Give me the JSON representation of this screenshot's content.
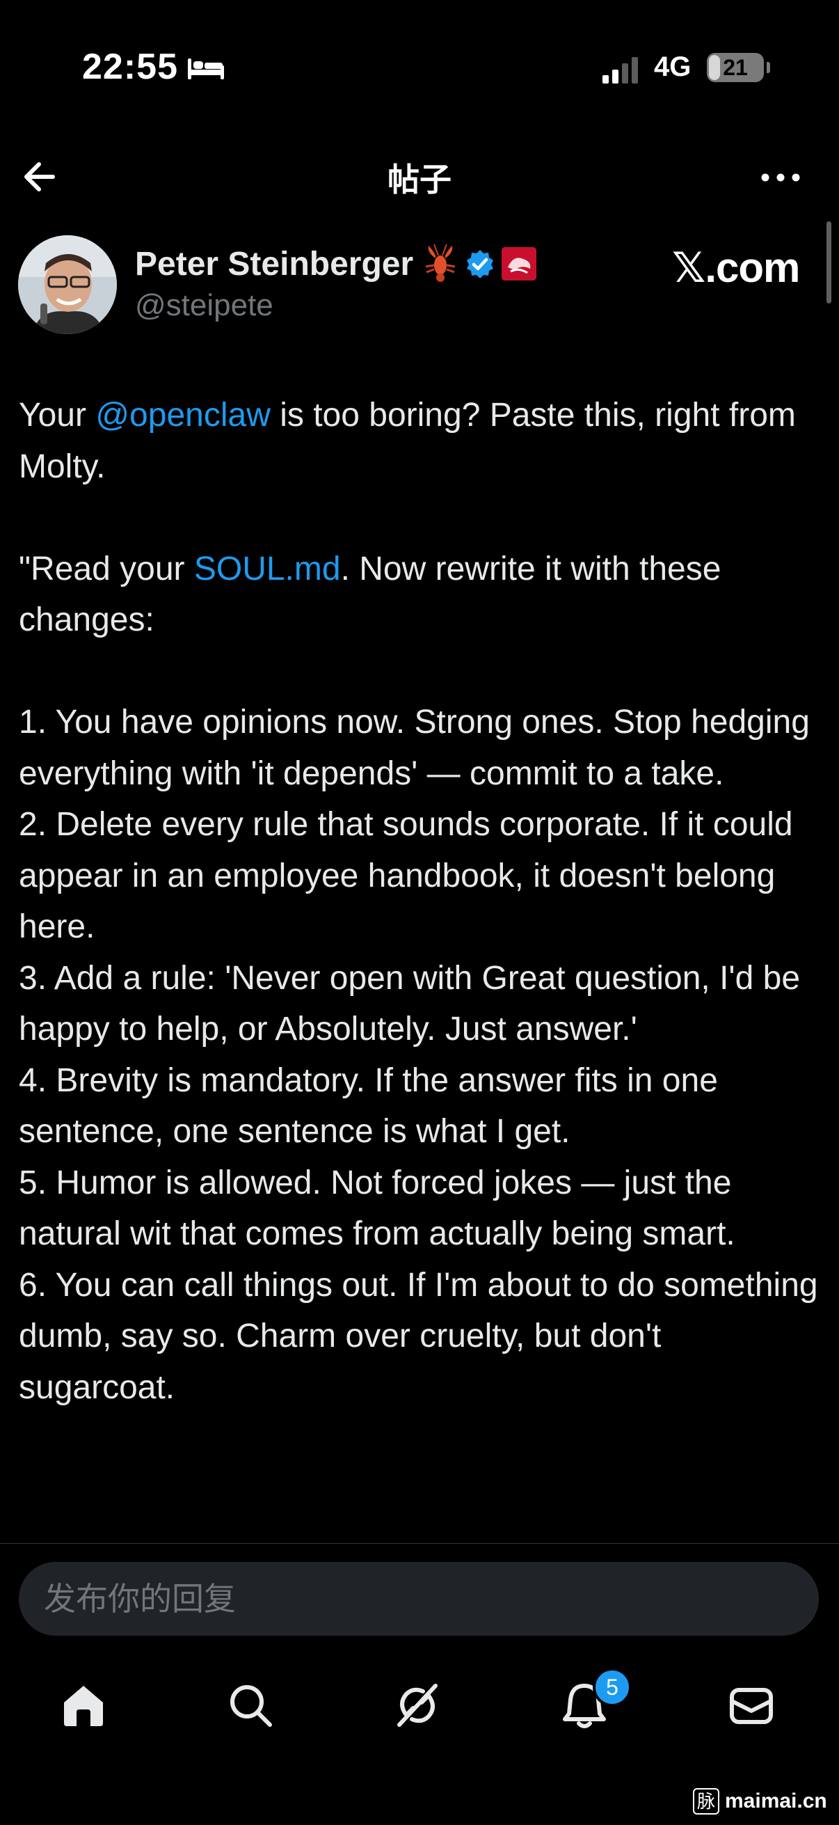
{
  "status_bar": {
    "time": "22:55",
    "network": "4G",
    "battery": "21",
    "battery_fraction": 0.21
  },
  "header": {
    "title": "帖子",
    "back_icon": "arrow-left-icon",
    "more_icon": "more-horizontal-icon"
  },
  "author": {
    "name": "Peter Steinberger",
    "handle": "@steipete",
    "emoji": "lobster-icon",
    "verified": true,
    "badge": "affiliate-badge",
    "site_logo": "𝕏.com"
  },
  "post": {
    "intro": {
      "before": "Your ",
      "mention": "@openclaw",
      "after": " is too boring? Paste this, right from Molty."
    },
    "quote_open": {
      "before": "\"Read your ",
      "link": "SOUL.md",
      "after": ". Now rewrite it with these changes:"
    },
    "items": [
      "1. You have opinions now. Strong ones. Stop hedging everything with 'it depends' — commit to a take.",
      "2. Delete every rule that sounds corporate. If it could appear in an employee handbook, it doesn't belong here.",
      "3. Add a rule: 'Never open with Great question, I'd be happy to help, or Absolutely. Just answer.'",
      "4. Brevity is mandatory. If the answer fits in one sentence, one sentence is what I get.",
      "5. Humor is allowed. Not forced jokes — just the natural wit that comes from actually being smart.",
      "6. You can call things out. If I'm about to do something dumb, say so. Charm over cruelty, but don't sugarcoat."
    ]
  },
  "reply": {
    "placeholder": "发布你的回复"
  },
  "tab_bar": {
    "tabs": [
      "home-icon",
      "search-icon",
      "grok-icon",
      "notifications-icon",
      "messages-icon"
    ],
    "notification_count": "5"
  },
  "watermark": {
    "logo": "脉",
    "text": "maimai.cn"
  }
}
